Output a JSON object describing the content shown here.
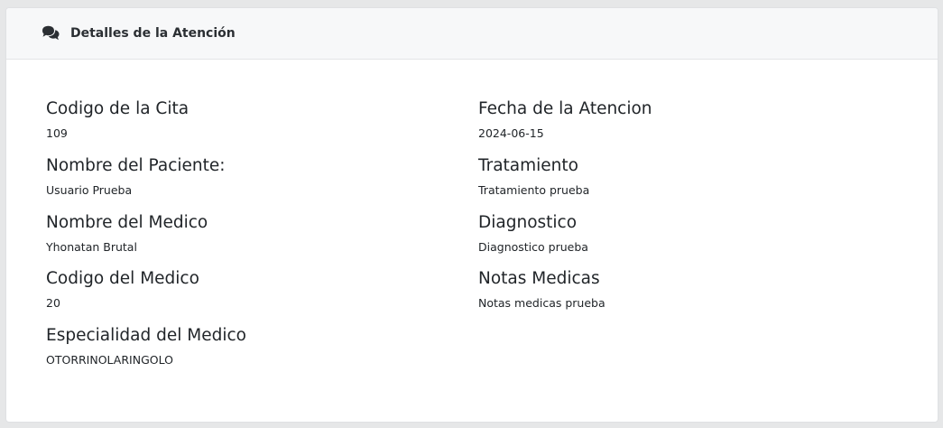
{
  "header": {
    "title": "Detalles de la Atención",
    "icon": "comments-icon"
  },
  "left_column": [
    {
      "label": "Codigo de la Cita",
      "value": "109"
    },
    {
      "label": "Nombre del Paciente:",
      "value": "Usuario Prueba"
    },
    {
      "label": "Nombre del Medico",
      "value": "Yhonatan Brutal"
    },
    {
      "label": "Codigo del Medico",
      "value": "20"
    },
    {
      "label": "Especialidad del Medico",
      "value": "OTORRINOLARINGOLO"
    }
  ],
  "right_column": [
    {
      "label": "Fecha de la Atencion",
      "value": "2024-06-15"
    },
    {
      "label": "Tratamiento",
      "value": "Tratamiento prueba"
    },
    {
      "label": "Diagnostico",
      "value": "Diagnostico prueba"
    },
    {
      "label": "Notas Medicas",
      "value": "Notas medicas prueba"
    }
  ],
  "colors": {
    "page_background": "#e6e7e8",
    "card_header_background": "#f7f8f9",
    "text": "#212529"
  }
}
